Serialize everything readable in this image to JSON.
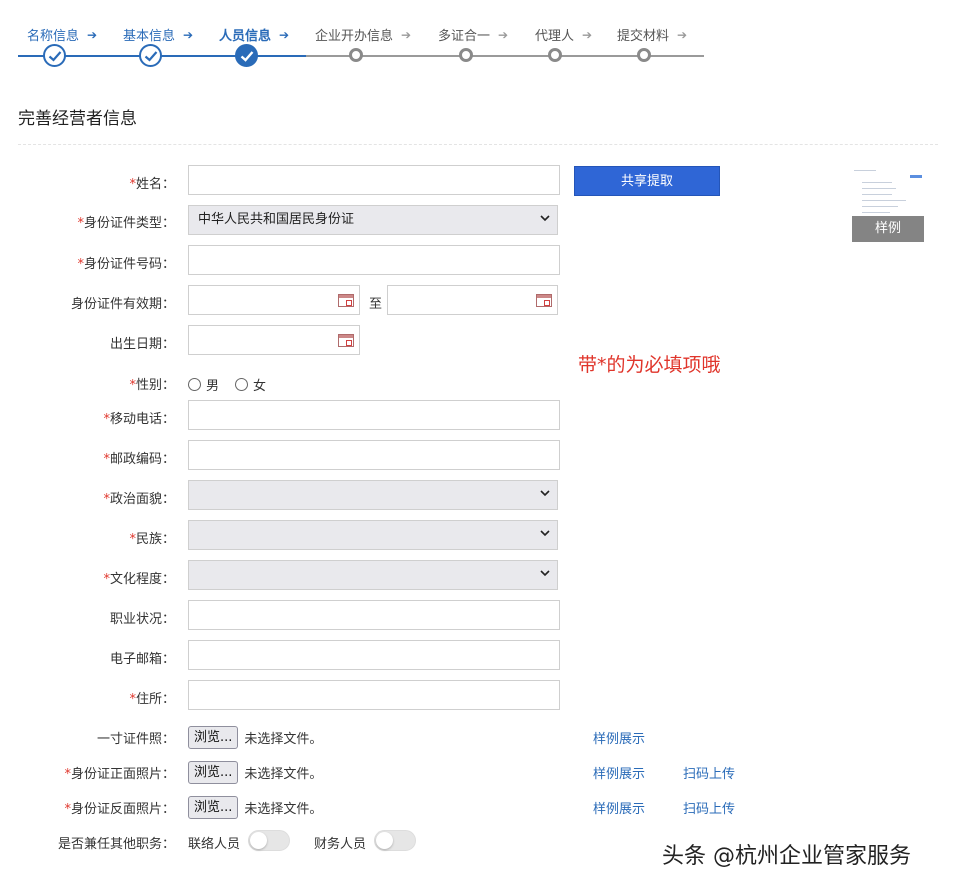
{
  "stepper": {
    "steps": [
      {
        "label": "名称信息",
        "state": "done"
      },
      {
        "label": "基本信息",
        "state": "done"
      },
      {
        "label": "人员信息",
        "state": "active"
      },
      {
        "label": "企业开办信息",
        "state": "pending"
      },
      {
        "label": "多证合一",
        "state": "pending"
      },
      {
        "label": "代理人",
        "state": "pending"
      },
      {
        "label": "提交材料",
        "state": "pending"
      }
    ],
    "arrow": "➔",
    "colors": {
      "done": "#2a6bb8",
      "pending": "#8a8a8a"
    }
  },
  "section": {
    "title": "完善经营者信息"
  },
  "form": {
    "required_mark": "*",
    "name_label": "姓名：",
    "id_type_label": "身份证件类型：",
    "id_type_value": "中华人民共和国居民身份证",
    "id_number_label": "身份证件号码：",
    "id_validity_label": "身份证件有效期：",
    "to_label": "至",
    "birth_label": "出生日期：",
    "gender_label": "性别：",
    "gender_male": "男",
    "gender_female": "女",
    "mobile_label": "移动电话：",
    "postal_label": "邮政编码：",
    "political_label": "政治面貌：",
    "ethnic_label": "民族：",
    "education_label": "文化程度：",
    "occupation_label": "职业状况：",
    "email_label": "电子邮箱：",
    "address_label": "住所：",
    "photo_label": "一寸证件照：",
    "id_front_label": "身份证正面照片：",
    "id_back_label": "身份证反面照片：",
    "browse_label": "浏览...",
    "no_file_label": "未选择文件。",
    "sample_link": "样例展示",
    "scan_upload_link": "扫码上传",
    "other_duty_label": "是否兼任其他职务：",
    "liaison_label": "联络人员",
    "finance_label": "财务人员"
  },
  "share_button": "共享提取",
  "sample_thumb_label": "样例",
  "note": "带*的为必填项哦",
  "watermark": "头条 @杭州企业管家服务",
  "accent_color": "#2f66d6",
  "required_color": "#e0352b"
}
